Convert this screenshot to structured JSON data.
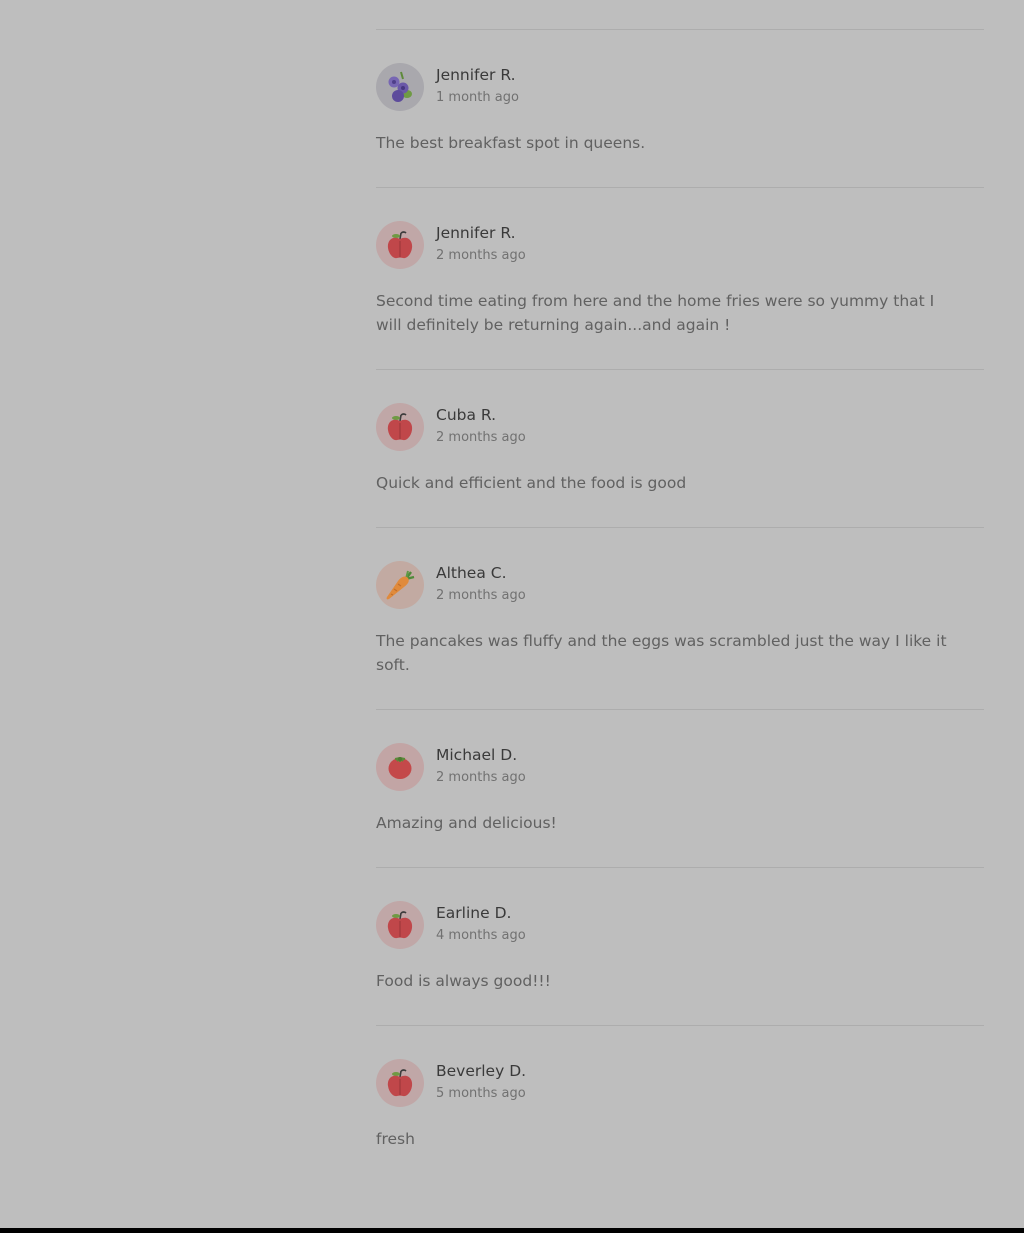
{
  "reviews": [
    {
      "name": "Jennifer R.",
      "date": "1 month ago",
      "text": "The best breakfast spot in queens.",
      "avatar_icon": "blueberry-icon"
    },
    {
      "name": "Jennifer R.",
      "date": "2 months ago",
      "text": "Second time eating from here and the home fries were so yummy that I will definitely be returning again...and again !",
      "avatar_icon": "apple-icon"
    },
    {
      "name": "Cuba R.",
      "date": "2 months ago",
      "text": "Quick and efficient and the food is good",
      "avatar_icon": "apple-icon"
    },
    {
      "name": "Althea C.",
      "date": "2 months ago",
      "text": "The pancakes was fluffy and the eggs was scrambled just the way I like it soft.",
      "avatar_icon": "carrot-icon"
    },
    {
      "name": "Michael D.",
      "date": "2 months ago",
      "text": "Amazing and delicious!",
      "avatar_icon": "tomato-icon"
    },
    {
      "name": "Earline D.",
      "date": "4 months ago",
      "text": "Food is always good!!!",
      "avatar_icon": "apple-icon"
    },
    {
      "name": "Beverley D.",
      "date": "5 months ago",
      "text": "fresh",
      "avatar_icon": "apple-icon"
    }
  ],
  "colors": {
    "page_background": "#bebebe",
    "divider": "#adadad",
    "name_text": "#3a3a3a",
    "body_text": "#616161",
    "date_text": "#717171"
  }
}
